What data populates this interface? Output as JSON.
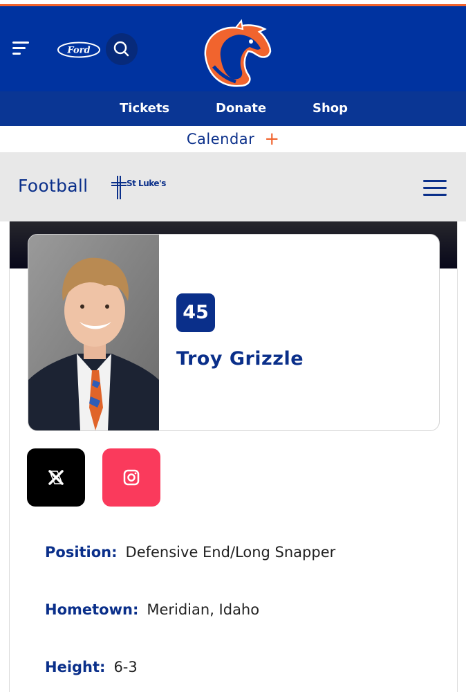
{
  "header": {
    "sponsor_logo": "Ford",
    "accent_color": "#f1642e",
    "brand_color": "#0033a0"
  },
  "nav": {
    "items": [
      "Tickets",
      "Donate",
      "Shop"
    ]
  },
  "calendar": {
    "label": "Calendar",
    "expand_symbol": "+"
  },
  "sport": {
    "title": "Football",
    "sponsor": "St Luke's"
  },
  "player": {
    "number": "45",
    "name": "Troy Grizzle"
  },
  "social": {
    "x_icon": "X",
    "instagram_icon": "instagram-icon"
  },
  "bio": [
    {
      "label": "Position:",
      "value": "Defensive End/Long Snapper"
    },
    {
      "label": "Hometown:",
      "value": "Meridian, Idaho"
    },
    {
      "label": "Height:",
      "value": "6-3"
    }
  ]
}
